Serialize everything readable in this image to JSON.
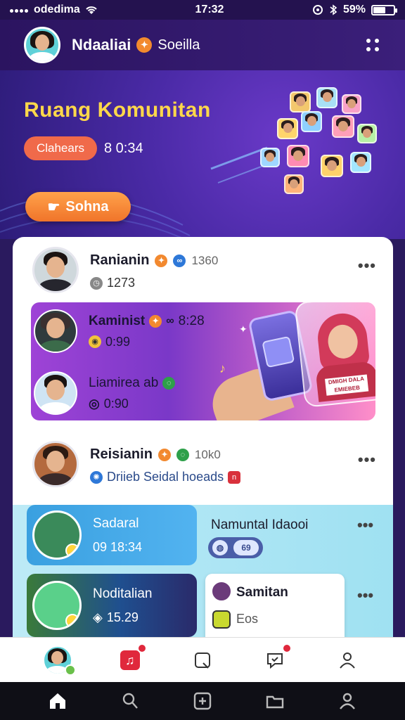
{
  "status_bar": {
    "carrier": "odedima",
    "time": "17:32",
    "battery": "59%",
    "battery_level": 0.59
  },
  "header": {
    "user_name": "Ndaaliai",
    "tag": "Soeilla",
    "menu_icon": "more-grid-icon"
  },
  "hero": {
    "title": "Ruang Komunitan",
    "badge": "Clahears",
    "time": "8 0:34",
    "button_label": "Sohna"
  },
  "feed": {
    "posts": [
      {
        "name": "Ranianin",
        "count": "1360",
        "sub": "1273"
      },
      {
        "name": "Reisianin",
        "count": "10k0",
        "sub": "Driieb Seidal hoeads"
      }
    ],
    "promo": {
      "rows": [
        {
          "name": "Kaminist",
          "meta": "8:28",
          "sub": "0:99"
        },
        {
          "name": "Liamirea ab",
          "meta": "",
          "sub": "0:90"
        }
      ],
      "sign_text": "DMIGH DALA EMIEBEB"
    },
    "cards": [
      {
        "title": "Sadaral",
        "sub": "09 18:34"
      },
      {
        "title": "Noditalian",
        "sub": "15.29"
      }
    ],
    "side_card": {
      "title": "Namuntal Idaooi",
      "pill_text": "69"
    },
    "sam_card": {
      "title": "Samitan",
      "sub": "Eos"
    }
  },
  "tabbar": {
    "items": [
      "profile",
      "music",
      "bookmark",
      "chat",
      "account"
    ]
  },
  "navbar": {
    "items": [
      "home",
      "search",
      "add",
      "folder",
      "person"
    ]
  },
  "colors": {
    "accent": "#ffd84a",
    "button": "#f0742a",
    "brand_purple": "#4a2aa6"
  }
}
